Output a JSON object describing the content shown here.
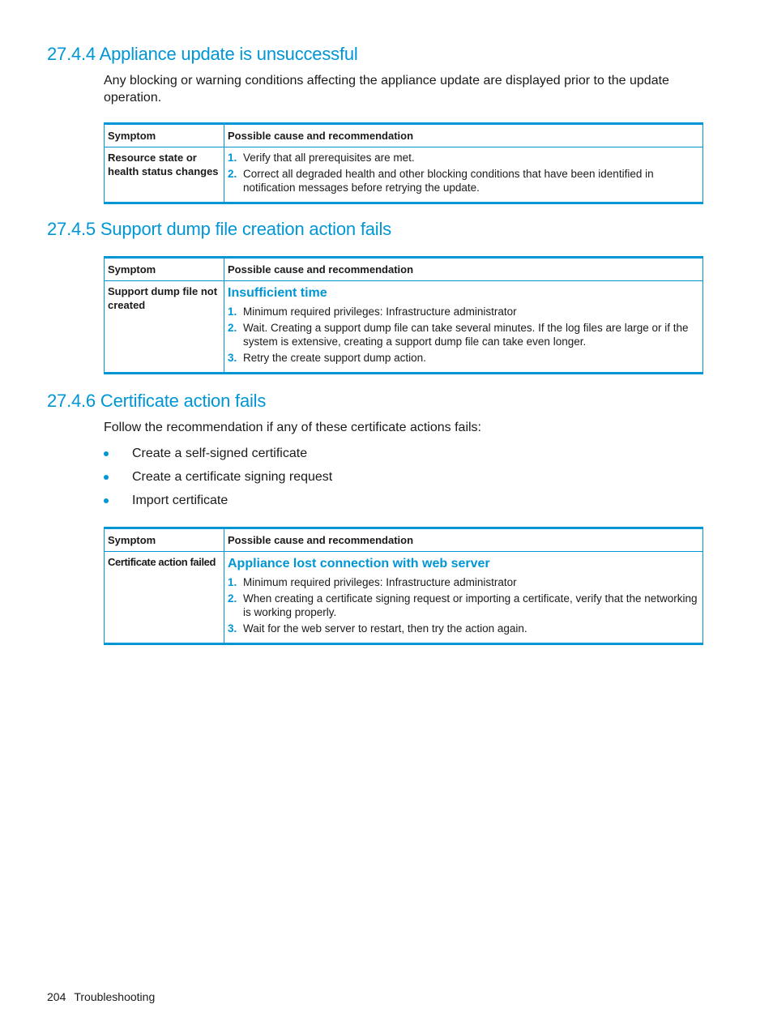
{
  "sections": [
    {
      "heading": "27.4.4 Appliance update is unsuccessful",
      "intro": "Any blocking or warning conditions affecting the appliance update are displayed prior to the update operation.",
      "table": {
        "headers": [
          "Symptom",
          "Possible cause and recommendation"
        ],
        "rows": [
          {
            "symptom": "Resource state or health status changes",
            "cause": "",
            "steps": [
              "Verify that all prerequisites are met.",
              "Correct all degraded health and other blocking conditions that have been identified in notification messages before retrying the update."
            ]
          }
        ]
      }
    },
    {
      "heading": "27.4.5 Support dump file creation action fails",
      "table": {
        "headers": [
          "Symptom",
          "Possible cause and recommendation"
        ],
        "rows": [
          {
            "symptom": "Support dump file not created",
            "cause": "Insufficient time",
            "steps": [
              "Minimum required privileges: Infrastructure administrator",
              "Wait. Creating a support dump file can take several minutes. If the log files are large or if the system is extensive, creating a support dump file can take even longer.",
              "Retry the create support dump action."
            ]
          }
        ]
      }
    },
    {
      "heading": "27.4.6 Certificate action fails",
      "intro": "Follow the recommendation if any of these certificate actions fails:",
      "bullets": [
        "Create a self-signed certificate",
        "Create a certificate signing request",
        "Import certificate"
      ],
      "table": {
        "headers": [
          "Symptom",
          "Possible cause and recommendation"
        ],
        "rows": [
          {
            "symptom": "Certificate action failed",
            "cause": "Appliance lost connection with web server",
            "steps": [
              "Minimum required privileges: Infrastructure administrator",
              "When creating a certificate signing request or importing a certificate, verify that the networking is working properly.",
              "Wait for the web server to restart, then try the action again."
            ]
          }
        ]
      }
    }
  ],
  "step_numbers": [
    "1.",
    "2.",
    "3."
  ],
  "footer": {
    "page_number": "204",
    "section": "Troubleshooting"
  },
  "colors": {
    "accent": "#0096d6",
    "text": "#1a1a1a"
  }
}
